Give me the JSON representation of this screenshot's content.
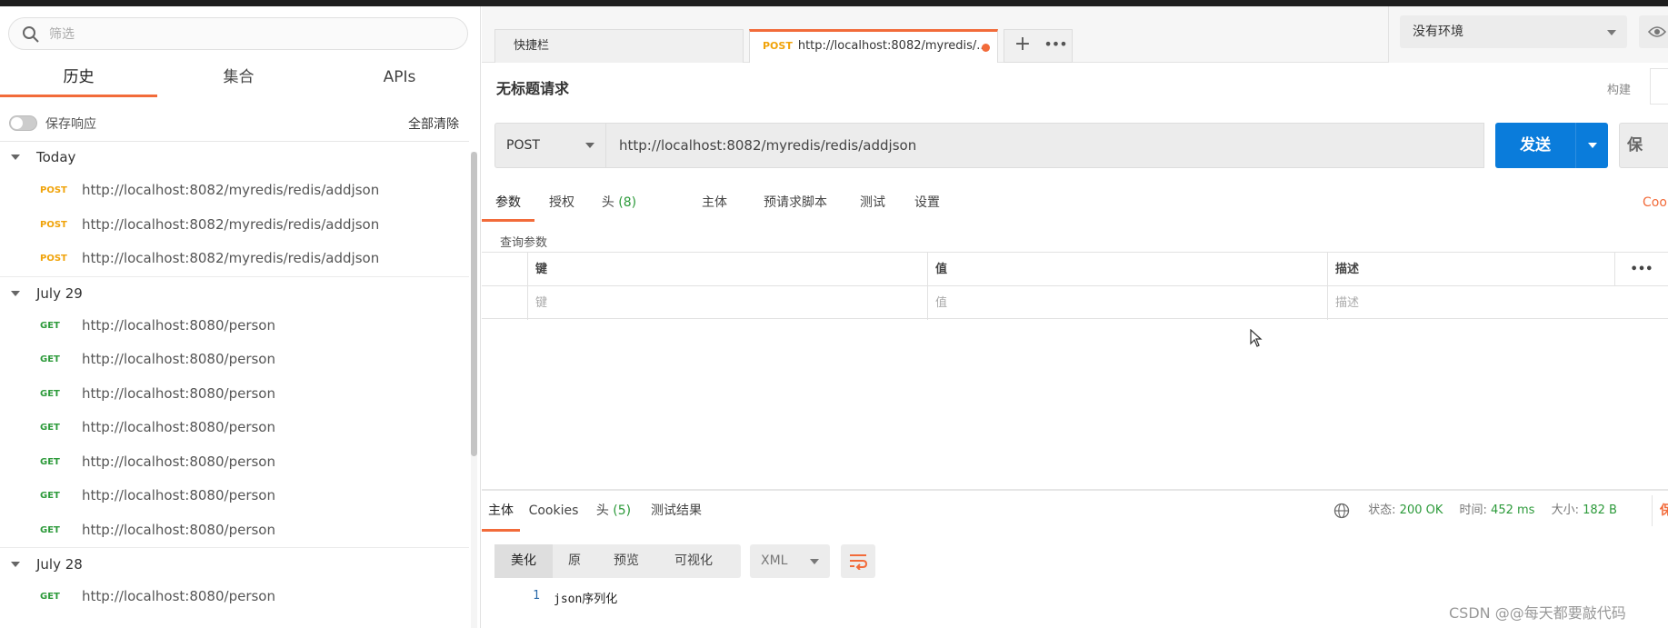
{
  "sidebar": {
    "search_placeholder": "筛选",
    "tabs": [
      {
        "label": "历史",
        "active": true
      },
      {
        "label": "集合",
        "active": false
      },
      {
        "label": "APIs",
        "active": false
      }
    ],
    "save_response_label": "保存响应",
    "save_response_on": false,
    "clear_all_label": "全部清除",
    "groups": [
      {
        "title": "Today",
        "items": [
          {
            "method": "POST",
            "url": "http://localhost:8082/myredis/redis/addjson"
          },
          {
            "method": "POST",
            "url": "http://localhost:8082/myredis/redis/addjson"
          },
          {
            "method": "POST",
            "url": "http://localhost:8082/myredis/redis/addjson"
          }
        ]
      },
      {
        "title": "July 29",
        "items": [
          {
            "method": "GET",
            "url": "http://localhost:8080/person"
          },
          {
            "method": "GET",
            "url": "http://localhost:8080/person"
          },
          {
            "method": "GET",
            "url": "http://localhost:8080/person"
          },
          {
            "method": "GET",
            "url": "http://localhost:8080/person"
          },
          {
            "method": "GET",
            "url": "http://localhost:8080/person"
          },
          {
            "method": "GET",
            "url": "http://localhost:8080/person"
          },
          {
            "method": "GET",
            "url": "http://localhost:8080/person"
          }
        ]
      },
      {
        "title": "July 28",
        "items": [
          {
            "method": "GET",
            "url": "http://localhost:8080/person"
          }
        ]
      }
    ]
  },
  "tabs": {
    "tab1_label": "快捷栏",
    "tab2_method": "POST",
    "tab2_label": "http://localhost:8082/myredis/..."
  },
  "env": {
    "selected": "没有环境"
  },
  "request": {
    "title": "无标题请求",
    "build_label": "构建",
    "method": "POST",
    "url": "http://localhost:8082/myredis/redis/addjson",
    "send_label": "发送",
    "save_label": "保",
    "tabs": {
      "params": "参数",
      "auth": "授权",
      "headers": "头",
      "headers_count": "(8)",
      "body": "主体",
      "prerequest": "预请求脚本",
      "tests": "测试",
      "settings": "设置"
    },
    "cookies_label": "Cook",
    "params_label": "查询参数",
    "params_table": {
      "headers": {
        "key": "键",
        "value": "值",
        "description": "描述",
        "more": "•••"
      },
      "placeholders": {
        "key": "键",
        "value": "值",
        "description": "描述"
      }
    }
  },
  "response": {
    "tabs": {
      "body": "主体",
      "cookies": "Cookies",
      "headers": "头",
      "headers_count": "(5)",
      "tests": "测试结果"
    },
    "status_label": "状态:",
    "status_value": "200 OK",
    "time_label": "时间:",
    "time_value": "452 ms",
    "size_label": "大小:",
    "size_value": "182 B",
    "save_label": "保存",
    "format_buttons": {
      "pretty": "美化",
      "raw": "原",
      "preview": "预览",
      "visualize": "可视化"
    },
    "language": "XML",
    "code_lines": [
      {
        "line": "1",
        "text": "json序列化"
      }
    ]
  },
  "watermark": "CSDN @@每天都要敲代码",
  "colors": {
    "accent": "#f26b3a",
    "send": "#0a7cdb",
    "post": "#f0a30a",
    "get": "#2c9a3a"
  }
}
